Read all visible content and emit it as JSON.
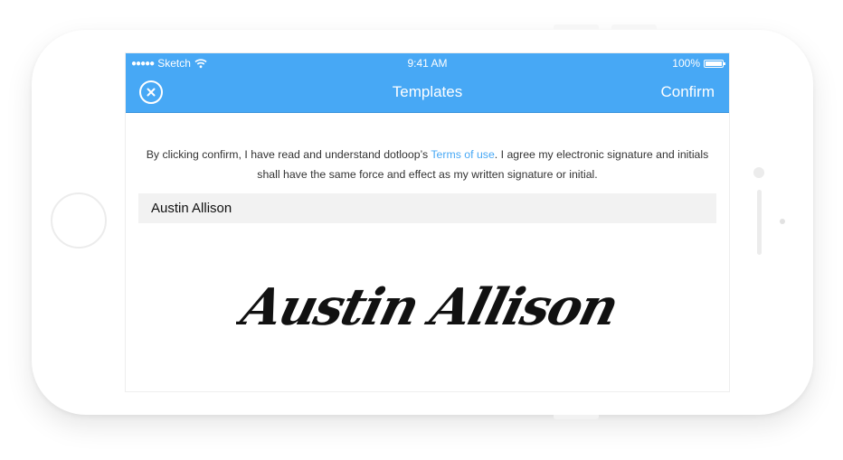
{
  "status_bar": {
    "carrier": "Sketch",
    "time": "9:41 AM",
    "battery": "100%",
    "icons": [
      "signal-icon",
      "wifi-icon",
      "battery-icon"
    ]
  },
  "nav": {
    "title": "Templates",
    "confirm_label": "Confirm",
    "close_icon": "close-icon"
  },
  "legal": {
    "text_before": "By clicking confirm, I have read and understand dotloop’s ",
    "link": "Terms of use",
    "text_after": ". I agree my electronic signature and initials shall have the same force and effect as my written signature or initial."
  },
  "signature": {
    "name": "Austin Allison",
    "signature_text": "Austin Allison"
  },
  "colors": {
    "accent": "#47a8f5",
    "header_bg": "#f2f2f2",
    "text": "#333333"
  }
}
